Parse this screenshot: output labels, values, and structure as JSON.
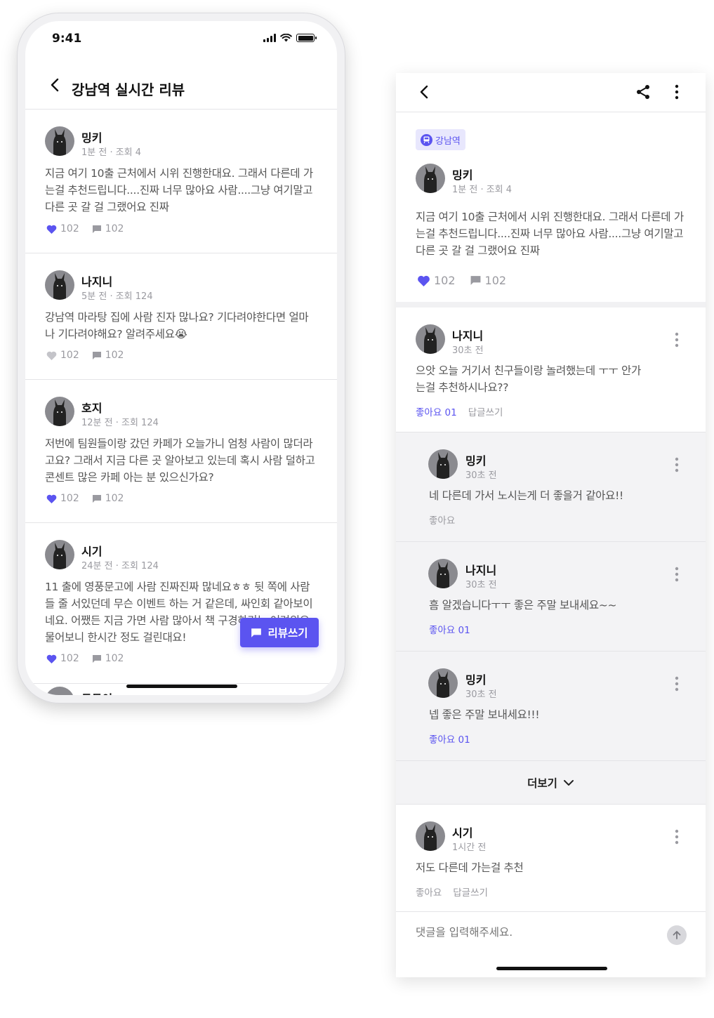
{
  "left": {
    "status": {
      "time": "9:41"
    },
    "header": {
      "title": "강남역 실시간 리뷰"
    },
    "posts": [
      {
        "name": "밍키",
        "meta": "1분 전 · 조회 4",
        "body": "지금 여기 10출 근처에서 시위 진행한대요. 그래서 다른데 가는걸 추천드립니다....진짜 너무 많아요 사람....그냥 여기말고 다른 곳 갈 걸 그랬어요 진짜",
        "likes": "102",
        "comments": "102",
        "liked": true
      },
      {
        "name": "나지니",
        "meta": "5분 전 · 조회 124",
        "body": "강남역 마라탕 집에 사람 진자 많나요? 기다려야한다면 얼마나 기다려야해요? 알려주세요😭",
        "likes": "102",
        "comments": "102",
        "liked": false
      },
      {
        "name": "호지",
        "meta": "12분 전 · 조회 124",
        "body": "저번에 팀원들이랑 갔던 카페가 오늘가니 엄청 사람이 많더라고요? 그래서 지금 다른 곳 알아보고 있는데 혹시 사람 덜하고 콘센트 많은 카페 아는 분 있으신가요?",
        "likes": "102",
        "comments": "102",
        "liked": true
      },
      {
        "name": "시기",
        "meta": "24분 전 · 조회 124",
        "body": "11 출에 영풍문고에 사람 진짜진짜 많네요ㅎㅎ 뒷 쪽에 사람들 줄 서있던데 무슨 이벤트 하는 거 같은데, 싸인회 같아보이네요. 어쨌든 지금 가면 사람 많아서 책 구경하기는 어려워요..물어보니 한시간 정도 걸린대요!",
        "likes": "102",
        "comments": "102",
        "liked": true
      }
    ],
    "peek_name": "두두이",
    "fab_label": "리뷰쓰기"
  },
  "right": {
    "tag": "강남역",
    "post": {
      "name": "밍키",
      "meta": "1분 전 · 조회 4",
      "body": "지금 여기 10출 근처에서 시위 진행한대요. 그래서 다른데 가는걸 추천드립니다....진짜 너무 많아요 사람....그냥 여기말고 다른 곳 갈 걸 그랬어요 진짜",
      "likes": "102",
      "comments": "102"
    },
    "comments": [
      {
        "name": "나지니",
        "time": "30초 전",
        "body": "으앗 오늘 거기서 친구들이랑 놀려했는데 ㅜㅜ 안가는걸 추천하시나요??",
        "like_label": "좋아요 01",
        "reply_label": "답글쓰기"
      },
      {
        "name": "밍키",
        "time": "30초 전",
        "body": "네 다른데 가서 노시는게 더 좋을거 같아요!!",
        "like_label": "좋아요"
      },
      {
        "name": "나지니",
        "time": "30초 전",
        "body": "흠 알겠습니다ㅜㅜ 좋은 주말 보내세요~~",
        "like_label": "좋아요 01"
      },
      {
        "name": "밍키",
        "time": "30초 전",
        "body": "넵 좋은 주말 보내세요!!!",
        "like_label": "좋아요 01"
      },
      {
        "name": "시기",
        "time": "1시간 전",
        "body": "저도 다른데 가는걸 추천",
        "like_label": "좋아요",
        "reply_label": "답글쓰기"
      }
    ],
    "more_label": "더보기",
    "input_placeholder": "댓글을 입력해주세요."
  },
  "colors": {
    "accent": "#5b54f0",
    "tag_bg": "#e8e7fd",
    "reply_bg": "#f3f3f5",
    "muted": "#9a9aa0"
  }
}
